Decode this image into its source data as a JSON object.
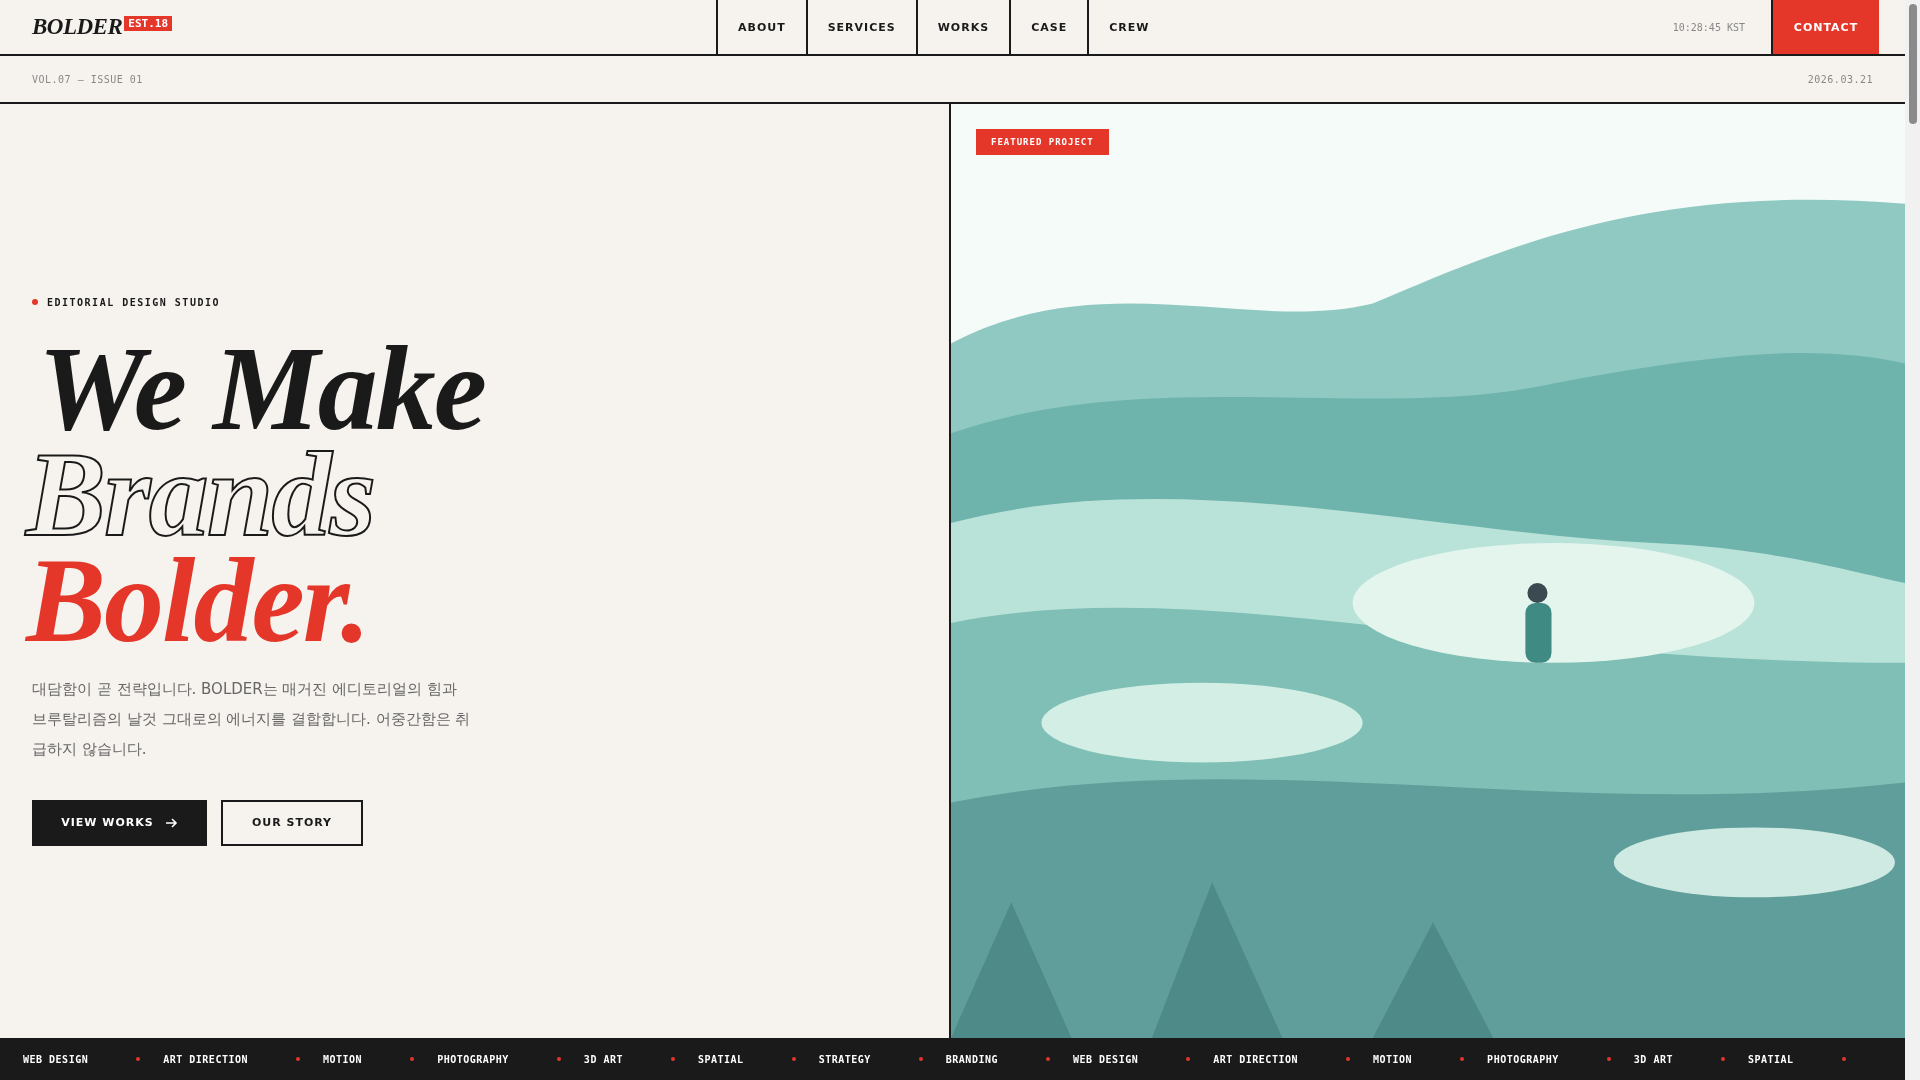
{
  "header": {
    "logo": "BOLDER",
    "logo_badge": "EST.18",
    "nav": [
      "ABOUT",
      "SERVICES",
      "WORKS",
      "CASE",
      "CREW"
    ],
    "clock": "10:28:45 KST",
    "contact": "CONTACT"
  },
  "subbar": {
    "issue": "VOL.07 — ISSUE 01",
    "date": "2026.03.21"
  },
  "hero": {
    "eyebrow": "EDITORIAL DESIGN STUDIO",
    "headline": [
      {
        "text": "We Make",
        "kind": "solid"
      },
      {
        "text": "Brands",
        "kind": "outline"
      },
      {
        "text": "Bolder.",
        "kind": "accent"
      }
    ],
    "description": "대담함이 곧 전략입니다. BOLDER는 매거진 에디토리얼의 힘과 브루탈리즘의 날것 그대로의 에너지를 결합합니다. 어중간함은 취급하지 않습니다.",
    "buttons": [
      {
        "label": "VIEW WORKS",
        "kind": "primary"
      },
      {
        "label": "OUR STORY",
        "kind": "secondary"
      }
    ]
  },
  "feature": {
    "tag": "FEATURED PROJECT"
  },
  "ticker": [
    "WEB DESIGN",
    "ART DIRECTION",
    "MOTION",
    "PHOTOGRAPHY",
    "3D ART",
    "SPATIAL",
    "STRATEGY",
    "BRANDING",
    "WEB DESIGN",
    "ART DIRECTION",
    "MOTION",
    "PHOTOGRAPHY",
    "3D ART",
    "SPATIAL"
  ]
}
